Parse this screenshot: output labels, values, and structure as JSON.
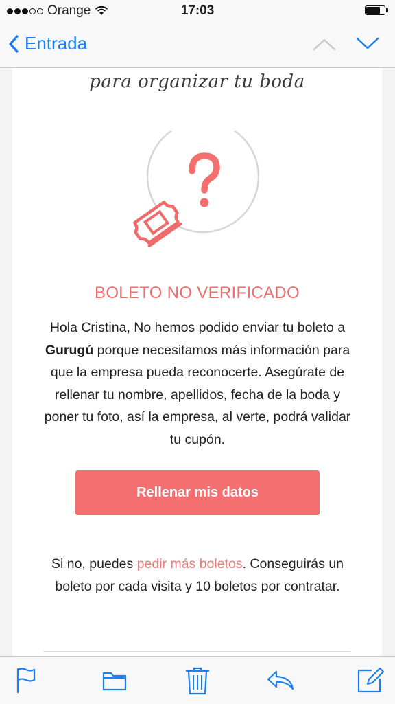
{
  "status_bar": {
    "signal_dots_filled": 3,
    "signal_dots_total": 5,
    "carrier": "Orange",
    "time": "17:03",
    "battery_level": 0.75
  },
  "nav": {
    "back_label": "Entrada",
    "icons": [
      "chevron-left-icon",
      "chevron-up-icon",
      "chevron-down-icon"
    ]
  },
  "email": {
    "tagline": "para organizar tu boda",
    "heading": "BOLETO NO VERIFICADO",
    "body_before_bold": "Hola Cristina, No hemos podido enviar tu boleto a ",
    "body_bold": "Gurugú",
    "body_after_bold": " porque necesitamos más información para que la empresa pueda reconocerte. Asegúrate de rellenar tu nombre, apellidos, fecha de la boda y poner tu foto, así la empresa, al verte, podrá validar tu cupón.",
    "button_label": "Rellenar mis datos",
    "footer_before_link": "Si no, puedes ",
    "footer_link": "pedir más boletos",
    "footer_after_link": ". Conseguirás un boleto por cada visita y 10 boletos por contratar."
  },
  "toolbar": {
    "icons": [
      "flag-icon",
      "folder-icon",
      "trash-icon",
      "reply-icon",
      "compose-icon"
    ]
  },
  "colors": {
    "accent_blue": "#1a7ff2",
    "coral": "#f36f70",
    "heading_coral": "#ef6b6b"
  }
}
